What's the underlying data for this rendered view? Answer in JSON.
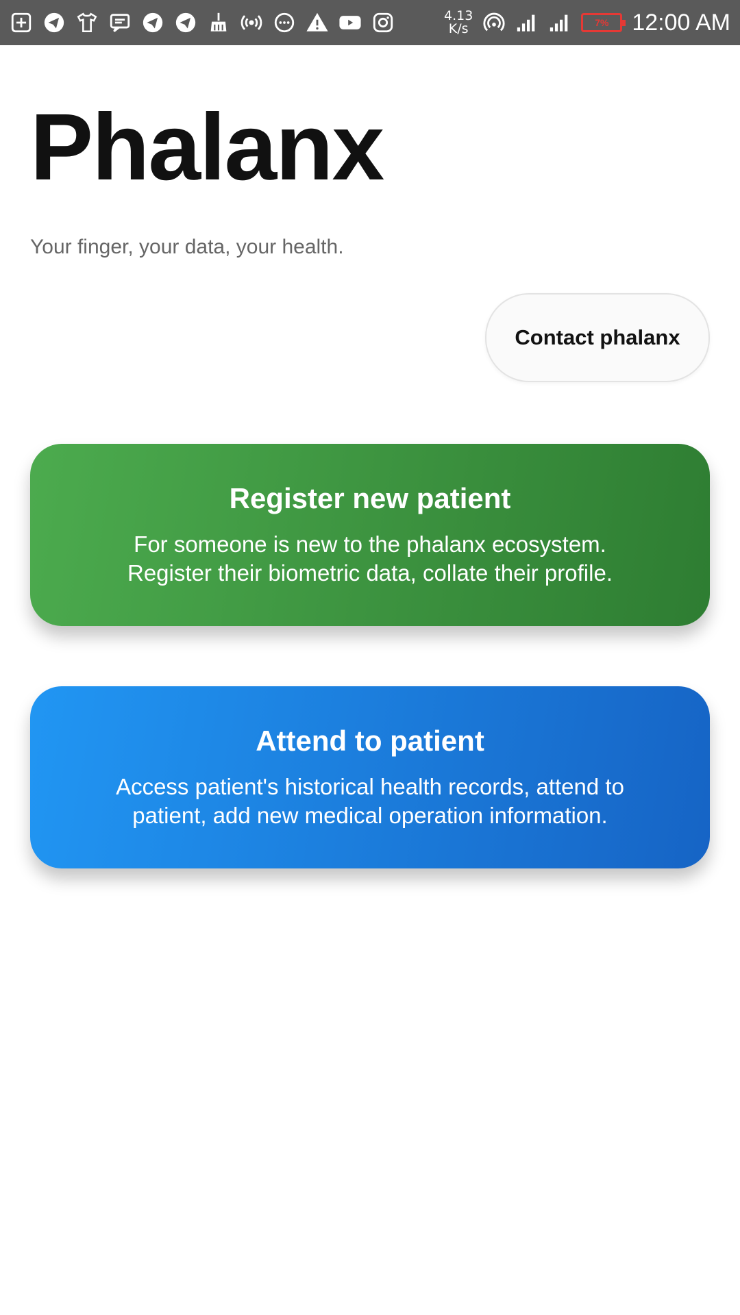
{
  "status_bar": {
    "left_icons": [
      "add-box-icon",
      "telegram-icon",
      "tshirt-icon",
      "message-icon",
      "telegram-icon",
      "telegram-icon",
      "broom-icon",
      "hotspot-icon",
      "chat-bubble-icon",
      "warning-icon",
      "youtube-icon",
      "instagram-icon"
    ],
    "network_speed_value": "4.13",
    "network_speed_unit": "K/s",
    "battery_percent": "7%",
    "battery_color": "#e53935",
    "time": "12:00 AM"
  },
  "header": {
    "title": "Phalanx",
    "tagline": "Your finger, your data, your health."
  },
  "contact_button": {
    "label": "Contact phalanx"
  },
  "cards": {
    "register": {
      "title": "Register new patient",
      "description": "For someone is new to the phalanx ecosystem.\nRegister their biometric data, collate their profile.",
      "color": "#43a047"
    },
    "attend": {
      "title": "Attend to patient",
      "description": "Access patient's historical health records, attend to\npatient, add new medical operation information.",
      "color": "#1e88e5"
    }
  }
}
